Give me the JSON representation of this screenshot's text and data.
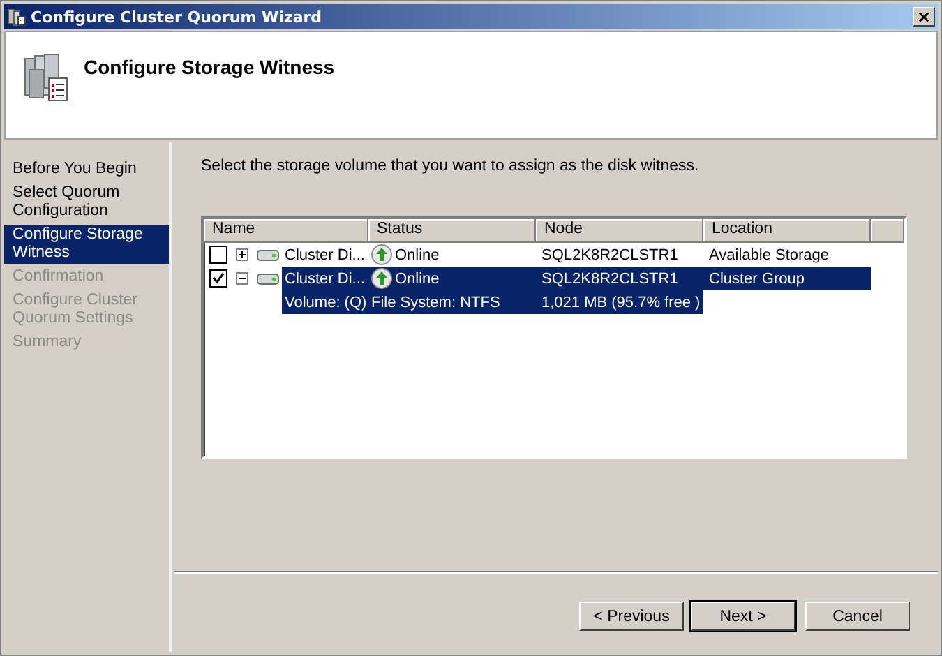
{
  "window": {
    "title": "Configure Cluster Quorum Wizard",
    "close": "×"
  },
  "header": {
    "title": "Configure Storage Witness"
  },
  "steps": [
    {
      "label": "Before You Begin",
      "selected": false,
      "disabled": false
    },
    {
      "label": "Select Quorum Configuration",
      "selected": false,
      "disabled": false
    },
    {
      "label": "Configure Storage Witness",
      "selected": true,
      "disabled": false
    },
    {
      "label": "Confirmation",
      "selected": false,
      "disabled": true
    },
    {
      "label": "Configure Cluster Quorum Settings",
      "selected": false,
      "disabled": true
    },
    {
      "label": "Summary",
      "selected": false,
      "disabled": true
    }
  ],
  "instruction": "Select the storage volume that you want to assign as the disk witness.",
  "table": {
    "columns": [
      "Name",
      "Status",
      "Node",
      "Location"
    ],
    "rows": [
      {
        "checked": false,
        "expanded": false,
        "selected": false,
        "name": "Cluster Di...",
        "status": "Online",
        "node": "SQL2K8R2CLSTR1",
        "location": "Available Storage"
      },
      {
        "checked": true,
        "expanded": true,
        "selected": true,
        "name": "Cluster Di...",
        "status": "Online",
        "node": "SQL2K8R2CLSTR1",
        "location": "Cluster Group",
        "details": {
          "volume": "Volume: (Q)",
          "file_system": "File System: NTFS",
          "size": "1,021 MB (95.7% free )"
        }
      }
    ]
  },
  "buttons": [
    {
      "label": "< Previous",
      "default": false
    },
    {
      "label": "Next >",
      "default": true
    },
    {
      "label": "Cancel",
      "default": false
    }
  ]
}
